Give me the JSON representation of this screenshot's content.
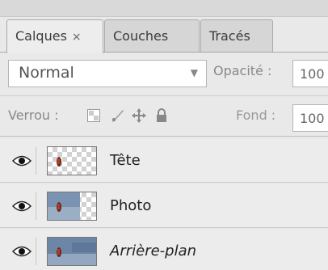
{
  "tabs": [
    {
      "label": "Calques",
      "close": "×"
    },
    {
      "label": "Couches"
    },
    {
      "label": "Tracés"
    }
  ],
  "blend_mode": {
    "value": "Normal"
  },
  "opacity": {
    "label": "Opacité :",
    "value": "100"
  },
  "lock": {
    "label": "Verrou :",
    "icons": [
      "lock-transparent-icon",
      "brush-icon",
      "move-icon",
      "padlock-icon"
    ]
  },
  "fill": {
    "label": "Fond :",
    "value": "100"
  },
  "layers": [
    {
      "name": "Tête",
      "visible": true,
      "italic": false,
      "thumb": "transparent-with-figure"
    },
    {
      "name": "Photo",
      "visible": true,
      "italic": false,
      "thumb": "partial-photo"
    },
    {
      "name": "Arrière-plan",
      "visible": true,
      "italic": true,
      "thumb": "photo"
    }
  ],
  "colors": {
    "panel": "#e9e9e9",
    "border": "#a9a9a9",
    "field": "#ffffff"
  }
}
